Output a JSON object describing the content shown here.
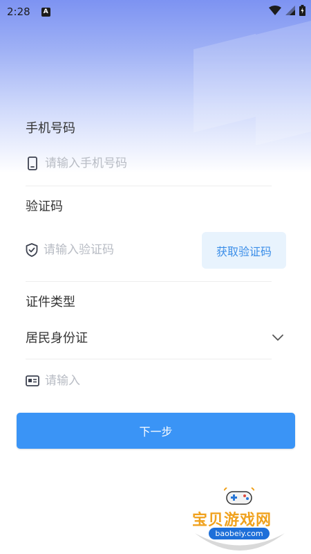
{
  "status_bar": {
    "time": "2:28",
    "notification_badge": "A"
  },
  "phone": {
    "label": "手机号码",
    "placeholder": "请输入手机号码"
  },
  "verification": {
    "label": "验证码",
    "placeholder": "请输入验证码",
    "get_code_label": "获取验证码"
  },
  "id_type": {
    "label": "证件类型",
    "selected_value": "居民身份证",
    "number_placeholder": "请输入"
  },
  "next_button_label": "下一步",
  "watermark": {
    "title": "宝贝游戏网",
    "url": "baobeiy.com"
  },
  "colors": {
    "accent": "#3a94f6",
    "code_button_bg": "#e8f3fd",
    "code_button_text": "#3b8ee8",
    "header_gradient_top": "#7d93f2",
    "placeholder": "#b8bcc4"
  },
  "icons": [
    "phone-icon",
    "shield-check-icon",
    "id-card-icon",
    "chevron-down-icon",
    "wifi-icon",
    "signal-icon",
    "battery-icon"
  ]
}
